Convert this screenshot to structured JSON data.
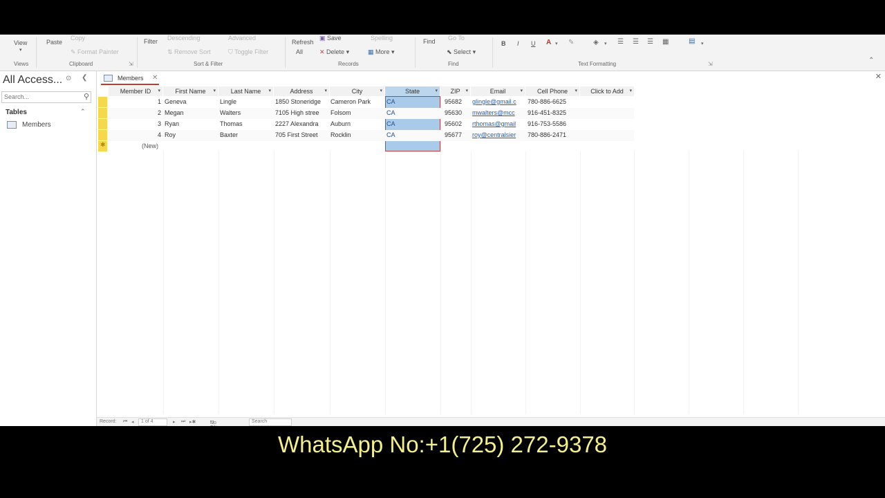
{
  "ribbon": {
    "views_label": "View",
    "clipboard": {
      "paste": "Paste",
      "copy": "Copy",
      "format_painter": "Format Painter",
      "group": "Clipboard"
    },
    "views_group": "Views",
    "sort_filter": {
      "filter": "Filter",
      "descending": "Descending",
      "advanced": "Advanced",
      "remove_sort": "Remove Sort",
      "toggle_filter": "Toggle Filter",
      "group": "Sort & Filter"
    },
    "records": {
      "refresh": "Refresh",
      "refresh_all": "All",
      "save": "Save",
      "delete": "Delete",
      "spelling": "Spelling",
      "more": "More",
      "group": "Records"
    },
    "find": {
      "find": "Find",
      "goto": "Go To",
      "select": "Select",
      "group": "Find"
    },
    "text_formatting": {
      "bold": "B",
      "italic": "I",
      "underline": "U",
      "group": "Text Formatting"
    }
  },
  "nav": {
    "title": "All Access...",
    "search_placeholder": "Search...",
    "group": "Tables",
    "items": [
      {
        "label": "Members"
      }
    ]
  },
  "doc": {
    "tab": "Members",
    "columns": [
      "Member ID",
      "First Name",
      "Last Name",
      "Address",
      "City",
      "State",
      "ZIP",
      "Email",
      "Cell Phone",
      "Click to Add"
    ],
    "rows": [
      {
        "id": "1",
        "first": "Geneva",
        "last": "Lingle",
        "address": "1850 Stoneridge",
        "city": "Cameron Park",
        "state": "CA",
        "zip": "95682",
        "email": "glingle@gmail.c",
        "phone": "780-886-6625"
      },
      {
        "id": "2",
        "first": "Megan",
        "last": "Walters",
        "address": "7105 High stree",
        "city": "Folsom",
        "state": "CA",
        "zip": "95630",
        "email": "mwalters@mcc",
        "phone": "916-451-8325"
      },
      {
        "id": "3",
        "first": "Ryan",
        "last": "Thomas",
        "address": "2227 Alexandra",
        "city": "Auburn",
        "state": "CA",
        "zip": "95602",
        "email": "rthomas@gmail",
        "phone": "916-753-5586"
      },
      {
        "id": "4",
        "first": "Roy",
        "last": "Baxter",
        "address": "705 First Street",
        "city": "Rocklin",
        "state": "CA",
        "zip": "95677",
        "email": "roy@centralsier",
        "phone": "780-886-2471"
      }
    ],
    "new_row": "(New)"
  },
  "status": {
    "record_label": "Record:",
    "record_pos": "1 of 4",
    "no_filter": "No Filter",
    "search": "Search"
  },
  "caption": "WhatsApp No:+1(725) 272-9378",
  "colors": {
    "selection": "#a9cbe9",
    "record_selector": "#f5d84b",
    "caption": "#f3ef8c"
  }
}
